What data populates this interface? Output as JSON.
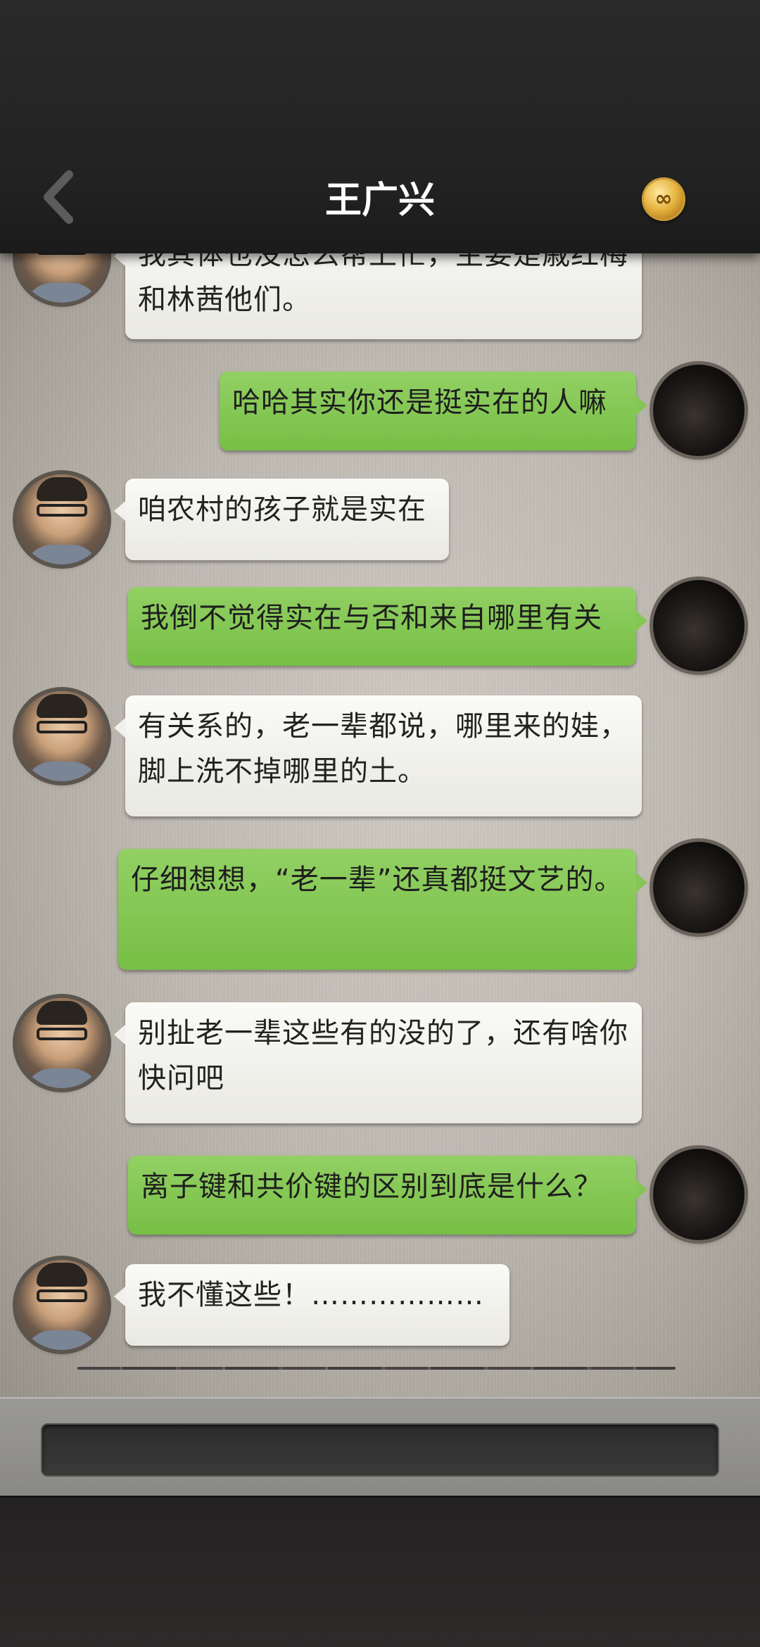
{
  "header": {
    "title": "王广兴",
    "back_icon": "chevron-left-icon",
    "coin_icon": "gold-coin-icon",
    "coin_symbol": "∞"
  },
  "messages": [
    {
      "side": "left",
      "text": "我其体也没怎么帮上忙，主要是戚红梅和林茜他们。"
    },
    {
      "side": "right",
      "text": "哈哈其实你还是挺实在的人嘛"
    },
    {
      "side": "left",
      "text": "咱农村的孩子就是实在"
    },
    {
      "side": "right",
      "text": "我倒不觉得实在与否和来自哪里有关"
    },
    {
      "side": "left",
      "text": "有关系的，老一辈都说，哪里来的娃，脚上洗不掉哪里的土。"
    },
    {
      "side": "right",
      "text": "仔细想想，“老一辈”还真都挺文艺的。"
    },
    {
      "side": "left",
      "text": "别扯老一辈这些有的没的了，还有啥你快问吧"
    },
    {
      "side": "right",
      "text": "离子键和共价键的区别到底是什么？"
    },
    {
      "side": "left",
      "text": "我不懂这些！………………"
    }
  ],
  "input": {
    "value": ""
  },
  "colors": {
    "header_bg": "#232222",
    "bubble_left": "#f1f0ec",
    "bubble_right": "#84c654",
    "input_bg": "#333333"
  }
}
